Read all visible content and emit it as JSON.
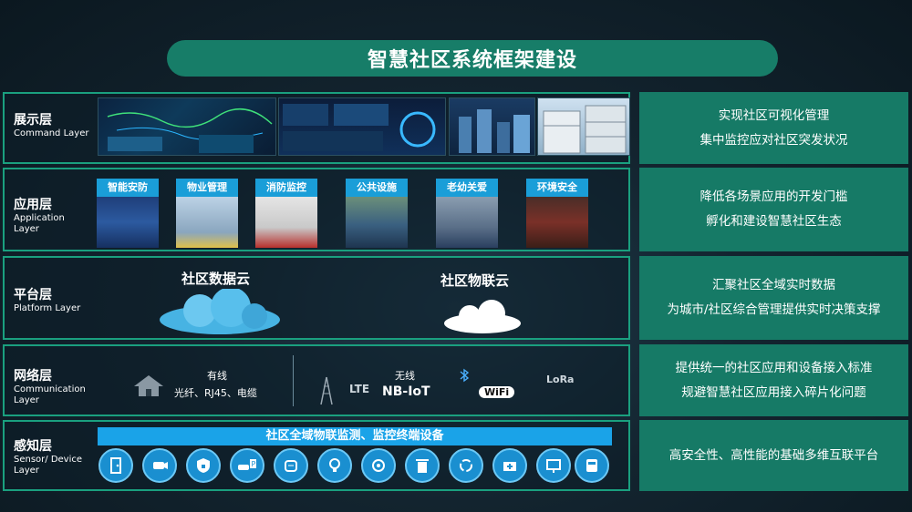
{
  "title": "智慧社区系统框架建设",
  "layers": [
    {
      "name": "展示层",
      "sub": "Command Layer",
      "desc": [
        "实现社区可视化管理",
        "集中监控应对社区突发状况"
      ]
    },
    {
      "name": "应用层",
      "sub": "Application Layer",
      "desc": [
        "降低各场景应用的开发门槛",
        "孵化和建设智慧社区生态"
      ]
    },
    {
      "name": "平台层",
      "sub": "Platform Layer",
      "desc": [
        "汇聚社区全域实时数据",
        "为城市/社区综合管理提供实时决策支撑"
      ]
    },
    {
      "name": "网络层",
      "sub": "Communication Layer",
      "desc": [
        "提供统一的社区应用和设备接入标准",
        "规避智慧社区应用接入碎片化问题"
      ]
    },
    {
      "name": "感知层",
      "sub": "Sensor/ Device Layer",
      "desc": [
        "高安全性、高性能的基础多维互联平台"
      ]
    }
  ],
  "apps": [
    "智能安防",
    "物业管理",
    "消防监控",
    "公共设施",
    "老幼关爱",
    "环境安全"
  ],
  "clouds": {
    "data": "社区数据云",
    "iot": "社区物联云"
  },
  "network": {
    "wired_title": "有线",
    "wired_detail": "光纤、RJ45、电缆",
    "wireless_title": "无线",
    "nbiot": "NB-IoT",
    "lte": "LTE",
    "wifi": "WiFi",
    "lora": "LoRa"
  },
  "sensor_banner": "社区全域物联监测、监控终端设备",
  "sensor_icons": [
    "door-icon",
    "camera-icon",
    "shield-lock-icon",
    "car-parking-icon",
    "mask-icon",
    "lightbulb-icon",
    "pump-icon",
    "trash-bin-icon",
    "cloud-sync-icon",
    "first-aid-box-icon",
    "monitor-icon",
    "meter-icon"
  ],
  "colors": {
    "accent": "#177d68",
    "border": "#1aa07f",
    "blue": "#1a9ed8"
  }
}
